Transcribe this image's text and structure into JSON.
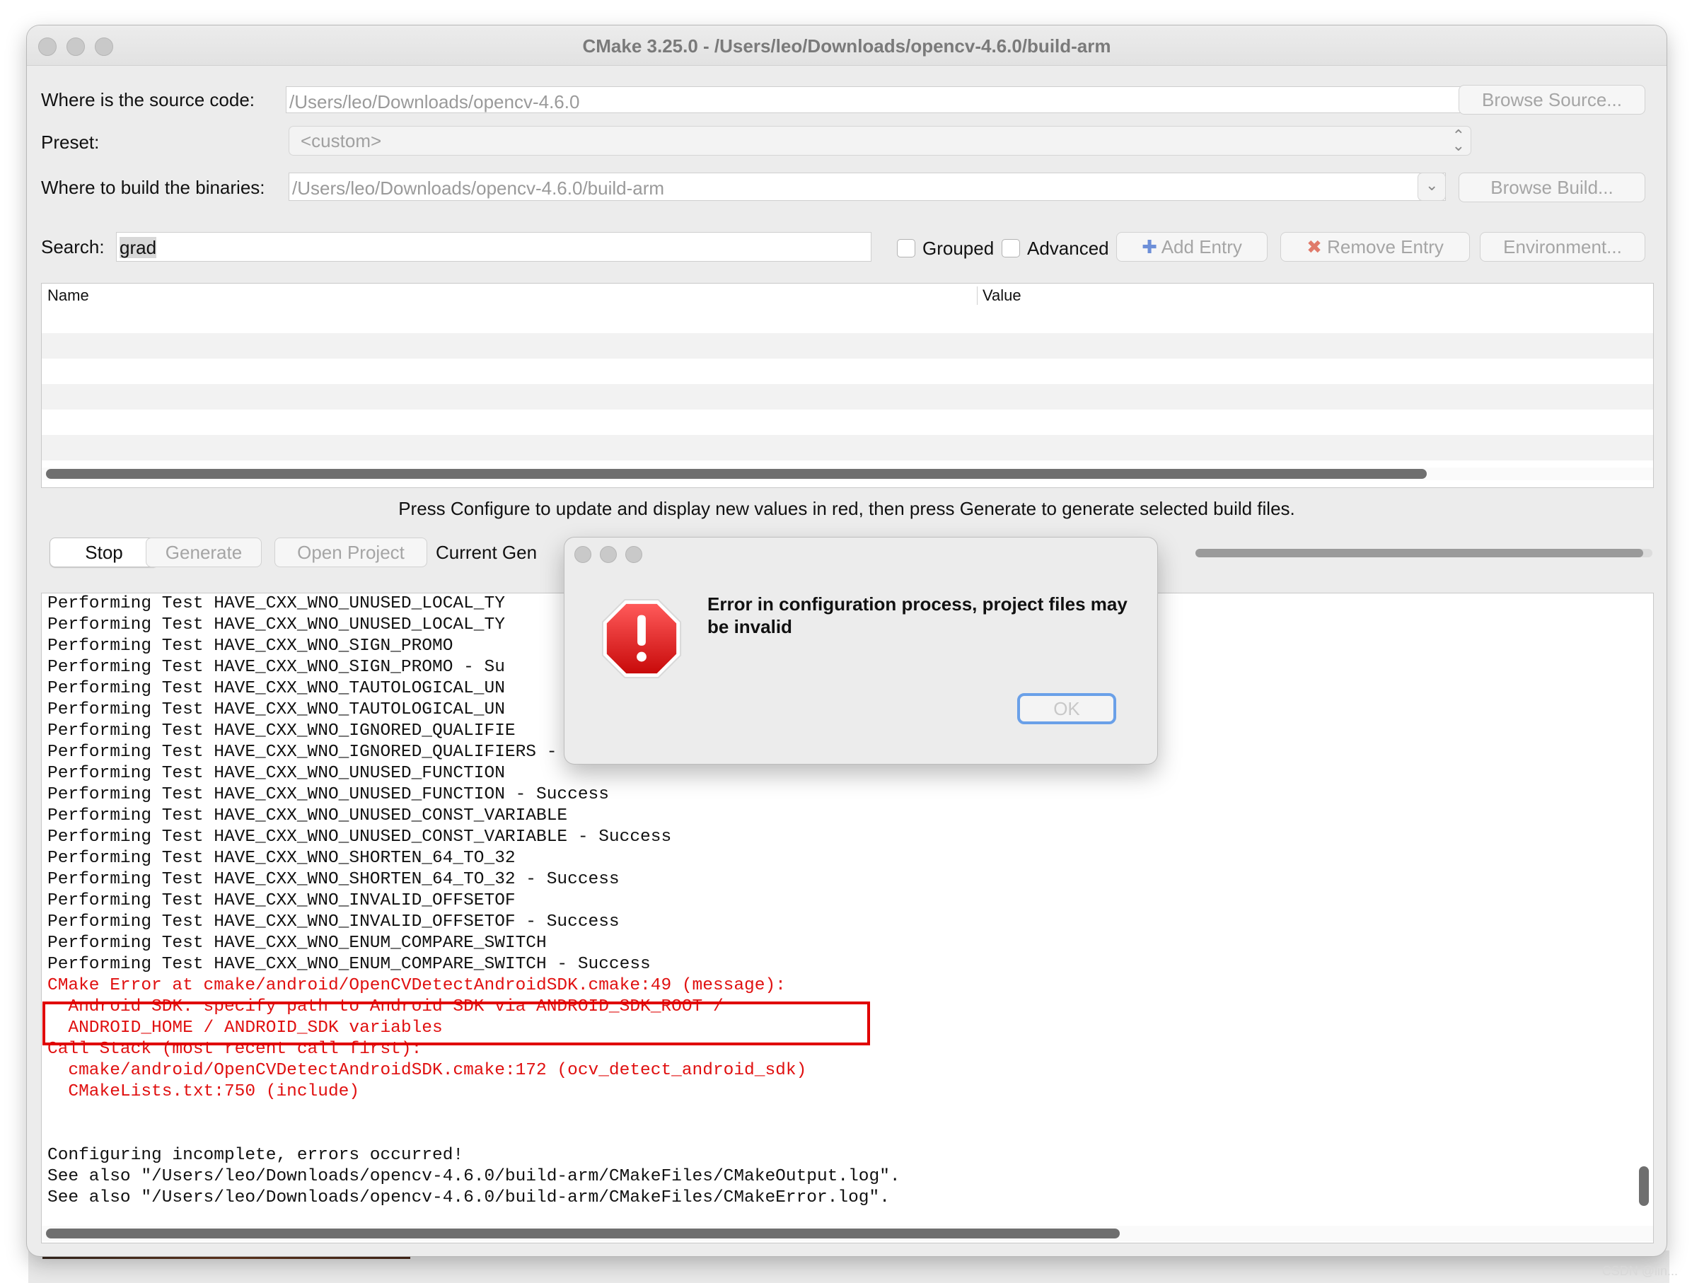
{
  "window": {
    "title": "CMake 3.25.0 - /Users/leo/Downloads/opencv-4.6.0/build-arm"
  },
  "form": {
    "source_label": "Where is the source code:",
    "source_value": "/Users/leo/Downloads/opencv-4.6.0",
    "browse_source": "Browse Source...",
    "preset_label": "Preset:",
    "preset_value": "<custom>",
    "build_label": "Where to build the binaries:",
    "build_value": "/Users/leo/Downloads/opencv-4.6.0/build-arm",
    "browse_build": "Browse Build...",
    "search_label": "Search:",
    "search_value": "grad",
    "grouped_label": "Grouped",
    "advanced_label": "Advanced",
    "add_entry": "Add Entry",
    "remove_entry": "Remove Entry",
    "environment": "Environment..."
  },
  "table": {
    "name_header": "Name",
    "value_header": "Value"
  },
  "hint": "Press Configure to update and display new values in red, then press Generate to generate selected build files.",
  "actions": {
    "stop": "Stop",
    "generate": "Generate",
    "open_project": "Open Project",
    "current_generator": "Current Gen",
    "progress": 0.98
  },
  "log_lines": [
    {
      "text": "Performing Test HAVE_CXX_WNO_UNUSED_LOCAL_TY",
      "error": false
    },
    {
      "text": "Performing Test HAVE_CXX_WNO_UNUSED_LOCAL_TY",
      "error": false
    },
    {
      "text": "Performing Test HAVE_CXX_WNO_SIGN_PROMO",
      "error": false
    },
    {
      "text": "Performing Test HAVE_CXX_WNO_SIGN_PROMO - Su",
      "error": false
    },
    {
      "text": "Performing Test HAVE_CXX_WNO_TAUTOLOGICAL_UN",
      "error": false
    },
    {
      "text": "Performing Test HAVE_CXX_WNO_TAUTOLOGICAL_UN",
      "error": false
    },
    {
      "text": "Performing Test HAVE_CXX_WNO_IGNORED_QUALIFIE",
      "error": false
    },
    {
      "text": "Performing Test HAVE_CXX_WNO_IGNORED_QUALIFIERS - Success",
      "error": false
    },
    {
      "text": "Performing Test HAVE_CXX_WNO_UNUSED_FUNCTION",
      "error": false
    },
    {
      "text": "Performing Test HAVE_CXX_WNO_UNUSED_FUNCTION - Success",
      "error": false
    },
    {
      "text": "Performing Test HAVE_CXX_WNO_UNUSED_CONST_VARIABLE",
      "error": false
    },
    {
      "text": "Performing Test HAVE_CXX_WNO_UNUSED_CONST_VARIABLE - Success",
      "error": false
    },
    {
      "text": "Performing Test HAVE_CXX_WNO_SHORTEN_64_TO_32",
      "error": false
    },
    {
      "text": "Performing Test HAVE_CXX_WNO_SHORTEN_64_TO_32 - Success",
      "error": false
    },
    {
      "text": "Performing Test HAVE_CXX_WNO_INVALID_OFFSETOF",
      "error": false
    },
    {
      "text": "Performing Test HAVE_CXX_WNO_INVALID_OFFSETOF - Success",
      "error": false
    },
    {
      "text": "Performing Test HAVE_CXX_WNO_ENUM_COMPARE_SWITCH",
      "error": false
    },
    {
      "text": "Performing Test HAVE_CXX_WNO_ENUM_COMPARE_SWITCH - Success",
      "error": false
    },
    {
      "text": "CMake Error at cmake/android/OpenCVDetectAndroidSDK.cmake:49 (message):",
      "error": true
    },
    {
      "text": "  Android SDK: specify path to Android SDK via ANDROID_SDK_ROOT /",
      "error": true
    },
    {
      "text": "  ANDROID_HOME / ANDROID_SDK variables",
      "error": true
    },
    {
      "text": "Call Stack (most recent call first):",
      "error": true
    },
    {
      "text": "  cmake/android/OpenCVDetectAndroidSDK.cmake:172 (ocv_detect_android_sdk)",
      "error": true
    },
    {
      "text": "  CMakeLists.txt:750 (include)",
      "error": true
    },
    {
      "text": "",
      "error": false
    },
    {
      "text": "",
      "error": false
    },
    {
      "text": "Configuring incomplete, errors occurred!",
      "error": false
    },
    {
      "text": "See also \"/Users/leo/Downloads/opencv-4.6.0/build-arm/CMakeFiles/CMakeOutput.log\".",
      "error": false
    },
    {
      "text": "See also \"/Users/leo/Downloads/opencv-4.6.0/build-arm/CMakeFiles/CMakeError.log\".",
      "error": false
    }
  ],
  "dialog": {
    "message": "Error in configuration process, project files may be invalid",
    "ok": "OK",
    "icon": "stop-exclamation-icon"
  },
  "colors": {
    "error_text": "#e01010",
    "highlight_box": "#e00000",
    "focus_ring": "#6aa0e8"
  },
  "watermark": "CSDN @lin..."
}
